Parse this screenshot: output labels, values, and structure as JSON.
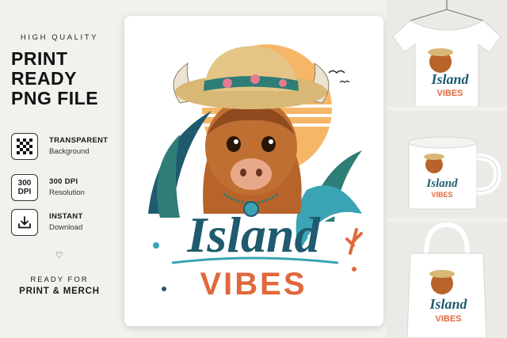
{
  "left": {
    "kicker": "HIGH QUALITY",
    "title_line1": "PRINT READY",
    "title_line2": "PNG FILE",
    "features": [
      {
        "icon": "checkerboard-icon",
        "title": "TRANSPARENT",
        "subtitle": "Background"
      },
      {
        "icon": "dpi-badge",
        "badge_line1": "300",
        "badge_line2": "DPI",
        "title": "300 DPI",
        "subtitle": "Resolution"
      },
      {
        "icon": "download-icon",
        "title": "INSTANT",
        "subtitle": "Download"
      }
    ],
    "ready_for": "READY FOR",
    "print_merch": "PRINT & MERCH"
  },
  "design": {
    "word1": "Island",
    "word2": "VIBES"
  },
  "mockups": [
    {
      "type": "t-shirt",
      "word1": "Island",
      "word2": "VIBES"
    },
    {
      "type": "mug",
      "word1": "Island",
      "word2": "VIBES"
    },
    {
      "type": "tote-bag",
      "word1": "Island",
      "word2": "VIBES"
    }
  ],
  "colors": {
    "teal": "#1f5a6e",
    "orange": "#e0683c",
    "sun": "#f4a94d",
    "fur": "#b8632a",
    "hat": "#d9b774"
  }
}
